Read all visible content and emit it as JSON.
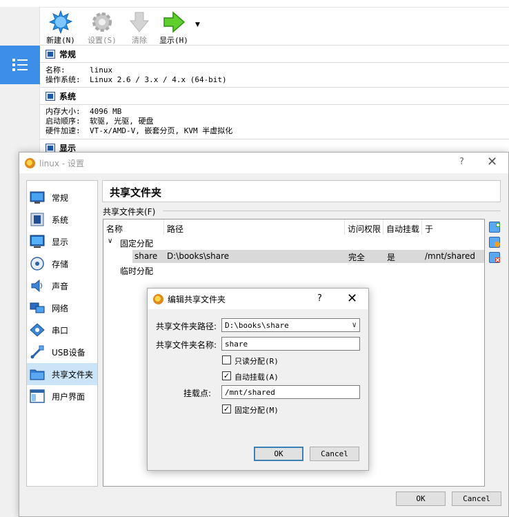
{
  "manager": {
    "toolbar": {
      "new": "新建(N)",
      "settings": "设置(S)",
      "discard": "清除",
      "show": "显示(H)"
    },
    "general": {
      "title": "常规",
      "name_key": "名称:",
      "name_val": "linux",
      "os_key": "操作系统:",
      "os_val": "Linux 2.6 / 3.x / 4.x (64-bit)"
    },
    "system": {
      "title": "系统",
      "mem_key": "内存大小:",
      "mem_val": "4096 MB",
      "boot_key": "启动顺序:",
      "boot_val": "软驱, 光驱, 硬盘",
      "accel_key": "硬件加速:",
      "accel_val": "VT-x/AMD-V, 嵌套分页, KVM 半虚拟化"
    },
    "display": {
      "title": "显示"
    }
  },
  "settings": {
    "title": "linux - 设置",
    "help": "?",
    "close": "✕",
    "nav": [
      {
        "label": "常规",
        "icon": "general-icon"
      },
      {
        "label": "系统",
        "icon": "system-icon"
      },
      {
        "label": "显示",
        "icon": "display-icon"
      },
      {
        "label": "存储",
        "icon": "storage-icon"
      },
      {
        "label": "声音",
        "icon": "audio-icon"
      },
      {
        "label": "网络",
        "icon": "network-icon"
      },
      {
        "label": "串口",
        "icon": "serial-port-icon"
      },
      {
        "label": "USB设备",
        "icon": "usb-icon"
      },
      {
        "label": "共享文件夹",
        "icon": "shared-folder-icon",
        "selected": true
      },
      {
        "label": "用户界面",
        "icon": "user-interface-icon"
      }
    ],
    "page_title": "共享文件夹",
    "group_label": "共享文件夹(F)",
    "columns": [
      "名称",
      "路径",
      "访问权限",
      "自动挂载",
      "于"
    ],
    "fixed_group": "固定分配",
    "row": {
      "name": "share",
      "path": "D:\\books\\share",
      "access": "完全",
      "auto": "是",
      "at": "/mnt/shared"
    },
    "temp_group": "临时分配",
    "ok": "OK",
    "cancel": "Cancel"
  },
  "edit_dialog": {
    "title": "编辑共享文件夹",
    "help": "?",
    "close": "✕",
    "path_label": "共享文件夹路径:",
    "path_value": "D:\\books\\share",
    "name_label": "共享文件夹名称:",
    "name_value": "share",
    "readonly_label": "只读分配(R)",
    "readonly_checked": false,
    "automount_label": "自动挂载(A)",
    "automount_checked": true,
    "mountpoint_label": "挂载点:",
    "mountpoint_value": "/mnt/shared",
    "permanent_label": "固定分配(M)",
    "permanent_checked": true,
    "ok": "OK",
    "cancel": "Cancel"
  },
  "colors": {
    "selection_blue": "#3d8ee6",
    "nav_selected": "#cce4f7",
    "row_selected": "#d9d9d9",
    "default_button_border": "#3c7fb1"
  }
}
